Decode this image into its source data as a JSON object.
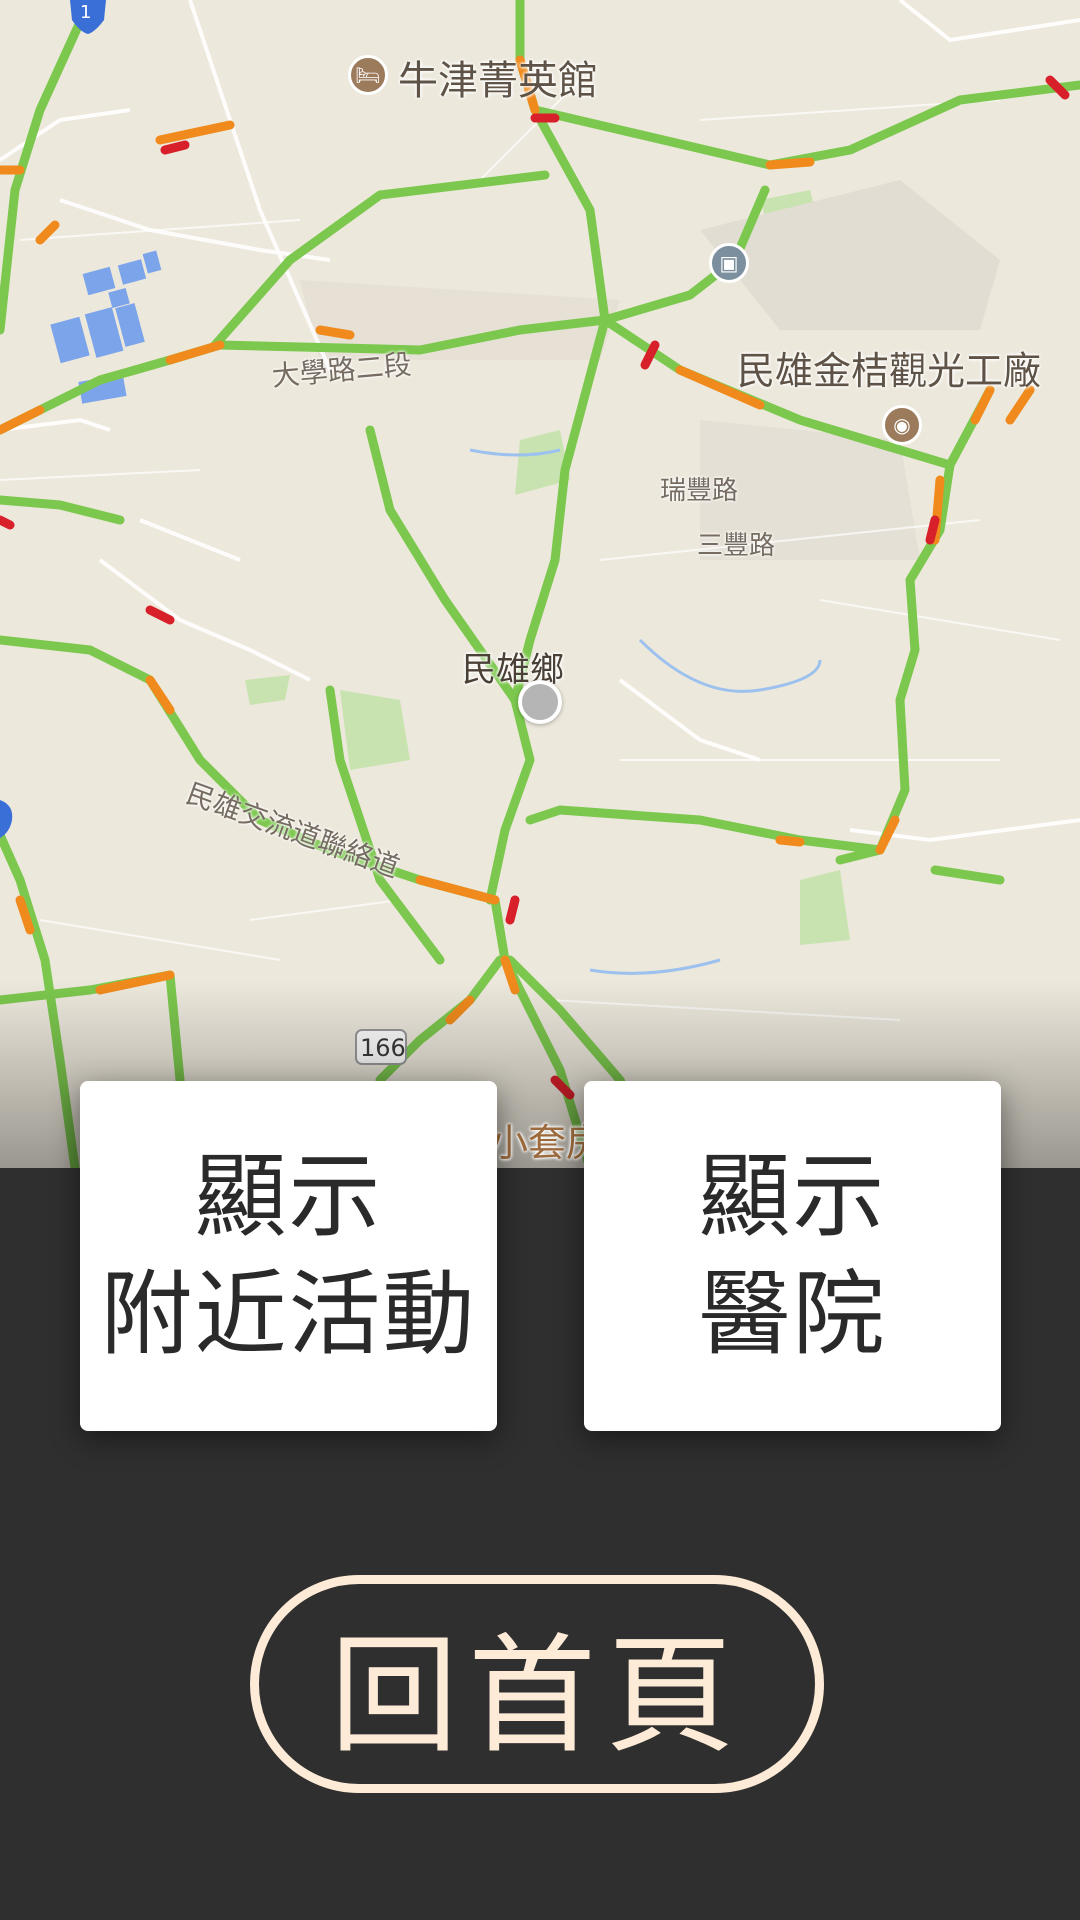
{
  "map": {
    "labels": {
      "hotel": "牛津菁英館",
      "factory": "民雄金桔觀光工廠",
      "township": "民雄鄉",
      "road_daxue": "大學路二段",
      "road_ruifeng": "瑞豐路",
      "road_sanfeng": "三豐路",
      "road_interchange": "民雄交流道聯絡道",
      "partial_label": "小套房",
      "route_shield": "166",
      "highway_shield": "1"
    },
    "icons": [
      "hotel-icon",
      "briefcase-icon",
      "camera-icon",
      "location-dot-icon"
    ],
    "colors": {
      "traffic_green": "#7cc84e",
      "traffic_orange": "#f08a1c",
      "traffic_red": "#d8202a",
      "water_blue": "#7ba4ea",
      "park_green": "#c8e3b0"
    }
  },
  "buttons": {
    "nearby_events": {
      "line1": "顯示",
      "line2": "附近活動"
    },
    "hospitals": {
      "line1": "顯示",
      "line2": "醫院"
    },
    "home": "回首頁"
  }
}
